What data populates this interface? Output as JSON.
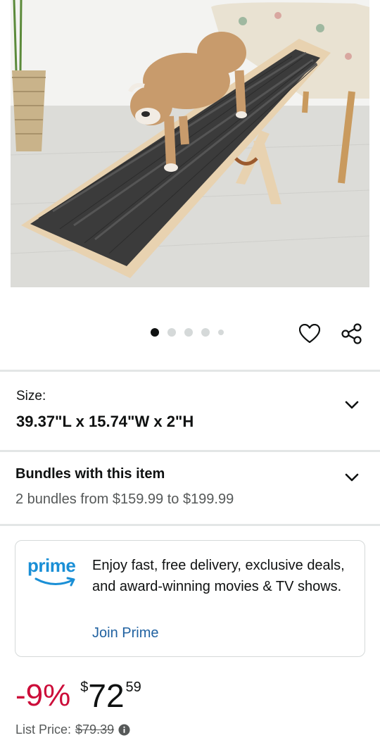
{
  "product_image": {
    "icon": "product-photo-dog-ramp"
  },
  "carousel": {
    "total": 5,
    "active_index": 0
  },
  "actions": {
    "favorite_icon": "heart-icon",
    "share_icon": "share-icon"
  },
  "size": {
    "label": "Size:",
    "value": "39.37\"L x 15.74\"W x 2\"H"
  },
  "bundles": {
    "title": "Bundles with this item",
    "subtitle": "2 bundles from $159.99 to $199.99"
  },
  "prime": {
    "logo_text": "prime",
    "description": "Enjoy fast, free delivery, exclusive deals, and award-winning movies & TV shows.",
    "link_label": "Join Prime"
  },
  "pricing": {
    "discount": "-9%",
    "currency_symbol": "$",
    "whole": "72",
    "fraction": "59",
    "list_price_label": "List Price:",
    "list_price_value": "$79.39"
  },
  "colors": {
    "discount_red": "#cc0c39",
    "link_blue": "#2162a1",
    "prime_blue": "#1a8fd6",
    "divider": "#e3e6e6"
  }
}
